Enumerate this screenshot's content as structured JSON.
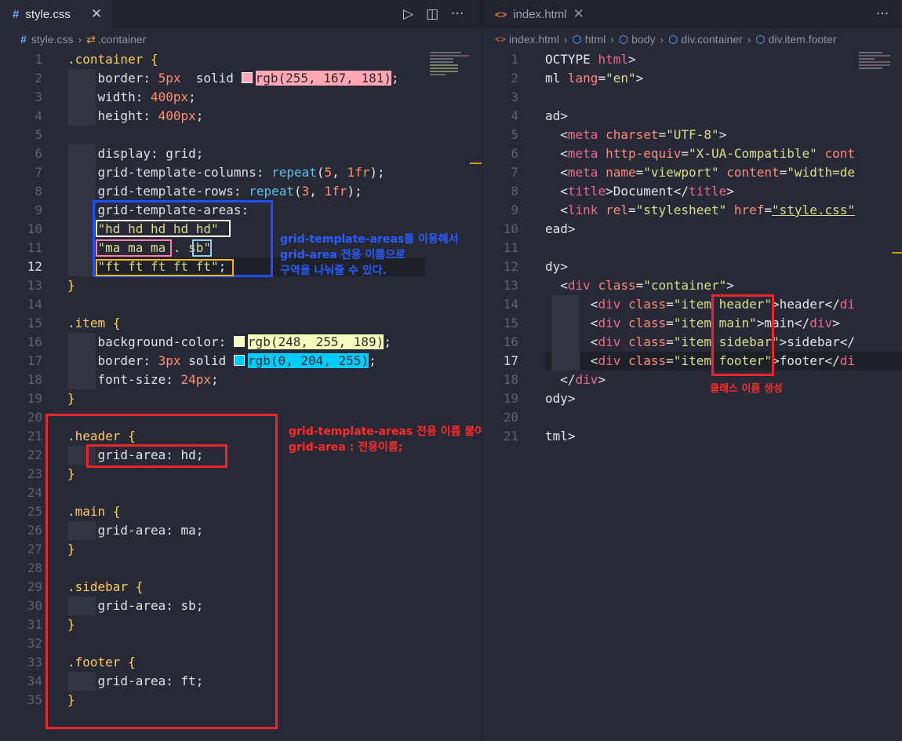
{
  "left": {
    "tab": {
      "icon": "#",
      "name": "style.css",
      "close": "✕"
    },
    "actions": {
      "run": "▷",
      "split": "◫",
      "more": "···"
    },
    "breadcrumb": {
      "file": "style.css",
      "symbol": ".container"
    },
    "lines": [
      {
        "n": "1",
        "html": "<span class='sel'>.container</span> <span class='pn'>{</span>"
      },
      {
        "n": "2",
        "html": "    <span class='p'>border</span>: <span class='n'>5px</span>  solid <span class='swatch' style='background:#ffa7b5'></span><span style='background:#ffa7b5;color:#2a2a2a'>rgb(<span>255</span>, <span>167</span>, <span>181</span>)</span>;"
      },
      {
        "n": "3",
        "html": "    <span class='p'>width</span>: <span class='n'>400px</span>;"
      },
      {
        "n": "4",
        "html": "    <span class='p'>height</span>: <span class='n'>400px</span>;"
      },
      {
        "n": "5",
        "html": ""
      },
      {
        "n": "6",
        "html": "    <span class='p'>display</span>: grid;"
      },
      {
        "n": "7",
        "html": "    <span class='p'>grid-template-columns</span>: <span class='f'>repeat</span>(<span class='n'>5</span>, <span class='n'>1fr</span>);"
      },
      {
        "n": "8",
        "html": "    <span class='p'>grid-template-rows</span>: <span class='f'>repeat</span>(<span class='n'>3</span>, <span class='n'>1fr</span>);"
      },
      {
        "n": "9",
        "html": "    <span class='p'>grid-template-areas</span>:"
      },
      {
        "n": "10",
        "html": "    <span class='s'>\"hd hd hd hd hd\"</span>"
      },
      {
        "n": "11",
        "html": "    <span class='s'>\"ma ma ma . sb\"</span>"
      },
      {
        "n": "12",
        "html": "    <span class='s'>\"ft ft ft ft ft\"</span>;"
      },
      {
        "n": "13",
        "html": "<span class='pn'>}</span>"
      },
      {
        "n": "14",
        "html": ""
      },
      {
        "n": "15",
        "html": "<span class='sel'>.item</span> <span class='pn'>{</span>"
      },
      {
        "n": "16",
        "html": "    <span class='p'>background-color</span>: <span class='swatch' style='background:#f8ffbd'></span><span style='background:#f8ffbd;color:#2a2a2a'>rgb(248, 255, 189)</span>;"
      },
      {
        "n": "17",
        "html": "    <span class='p'>border</span>: <span class='n'>3px</span> solid <span class='swatch' style='background:#00ccff'></span><span style='background:#00ccff;color:#2a2a2a'>rgb(0, 204, 255)</span>;"
      },
      {
        "n": "18",
        "html": "    <span class='p'>font-size</span>: <span class='n'>24px</span>;"
      },
      {
        "n": "19",
        "html": "<span class='pn'>}</span>"
      },
      {
        "n": "20",
        "html": ""
      },
      {
        "n": "21",
        "html": "<span class='sel'>.header</span> <span class='pn'>{</span>"
      },
      {
        "n": "22",
        "html": "    <span class='p'>grid-area</span>: hd;"
      },
      {
        "n": "23",
        "html": "<span class='pn'>}</span>"
      },
      {
        "n": "24",
        "html": ""
      },
      {
        "n": "25",
        "html": "<span class='sel'>.main</span> <span class='pn'>{</span>"
      },
      {
        "n": "26",
        "html": "    <span class='p'>grid-area</span>: ma;"
      },
      {
        "n": "27",
        "html": "<span class='pn'>}</span>"
      },
      {
        "n": "28",
        "html": ""
      },
      {
        "n": "29",
        "html": "<span class='sel'>.sidebar</span> <span class='pn'>{</span>"
      },
      {
        "n": "30",
        "html": "    <span class='p'>grid-area</span>: sb;"
      },
      {
        "n": "31",
        "html": "<span class='pn'>}</span>"
      },
      {
        "n": "32",
        "html": ""
      },
      {
        "n": "33",
        "html": "<span class='sel'>.footer</span> <span class='pn'>{</span>"
      },
      {
        "n": "34",
        "html": "    <span class='p'>grid-area</span>: ft;"
      },
      {
        "n": "35",
        "html": "<span class='pn'>}</span>"
      }
    ],
    "current_line": "12",
    "note_blue": "grid-template-areas를 이용해서\ngrid-area 전용 이름으로\n구역을 나눠줄 수 있다.",
    "note_red": "grid-template-areas 전용 이름 붙여주기\ngrid-area : 전용이름;"
  },
  "right": {
    "tab": {
      "icon": "<>",
      "name": "index.html",
      "close": "✕"
    },
    "actions": {
      "more": "···"
    },
    "breadcrumb": [
      "index.html",
      "html",
      "body",
      "div.container",
      "div.item.footer"
    ],
    "lines": [
      {
        "n": "1",
        "html": "OCTYPE <span class='k'>html</span>>"
      },
      {
        "n": "2",
        "html": "ml <span class='c1'>lang</span>=<span class='s'>\"en\"</span>>"
      },
      {
        "n": "3",
        "html": ""
      },
      {
        "n": "4",
        "html": "ad>"
      },
      {
        "n": "5",
        "html": "  &lt;<span class='k'>meta</span> <span class='c1'>charset</span>=<span class='s'>\"UTF-8\"</span>>"
      },
      {
        "n": "6",
        "html": "  &lt;<span class='k'>meta</span> <span class='c1'>http-equiv</span>=<span class='s'>\"X-UA-Compatible\"</span> <span class='c1'>cont</span>"
      },
      {
        "n": "7",
        "html": "  &lt;<span class='k'>meta</span> <span class='c1'>name</span>=<span class='s'>\"viewport\"</span> <span class='c1'>content</span>=<span class='s'>\"width=de</span>"
      },
      {
        "n": "8",
        "html": "  &lt;<span class='k'>title</span>>Document&lt;/<span class='k'>title</span>>"
      },
      {
        "n": "9",
        "html": "  &lt;<span class='k'>link</span> <span class='c1'>rel</span>=<span class='s'>\"stylesheet\"</span> <span class='c1'>href</span>=<span class='s' style='text-decoration:underline'>\"style.css\"</span>"
      },
      {
        "n": "10",
        "html": "ead>"
      },
      {
        "n": "11",
        "html": ""
      },
      {
        "n": "12",
        "html": "dy>"
      },
      {
        "n": "13",
        "html": "  &lt;<span class='k'>div</span> <span class='c1'>class</span>=<span class='s'>\"container\"</span>>"
      },
      {
        "n": "14",
        "html": "      &lt;<span class='k'>div</span> <span class='c1'>class</span>=<span class='s'>\"item header\"</span>>header&lt;/<span class='k'>di</span>"
      },
      {
        "n": "15",
        "html": "      &lt;<span class='k'>div</span> <span class='c1'>class</span>=<span class='s'>\"item main\"</span>>main&lt;/<span class='k'>div</span>>"
      },
      {
        "n": "16",
        "html": "      &lt;<span class='k'>div</span> <span class='c1'>class</span>=<span class='s'>\"item sidebar\"</span>>sidebar&lt;/"
      },
      {
        "n": "17",
        "html": "      &lt;<span class='k'>div</span> <span class='c1'>class</span>=<span class='s'>\"item footer\"</span>>footer&lt;/<span class='k'>di</span>"
      },
      {
        "n": "18",
        "html": "  &lt;/<span class='k'>div</span>>"
      },
      {
        "n": "19",
        "html": "ody>"
      },
      {
        "n": "20",
        "html": ""
      },
      {
        "n": "21",
        "html": "tml>"
      }
    ],
    "current_line": "17",
    "note_red": "클래스 이름 생성"
  },
  "colors": {
    "red": "#e8262c",
    "blue": "#1f4fff",
    "white": "#f5f5e0",
    "pink": "#ff7fa0",
    "cyan": "#8fd2e8",
    "gold": "#ffb400"
  }
}
